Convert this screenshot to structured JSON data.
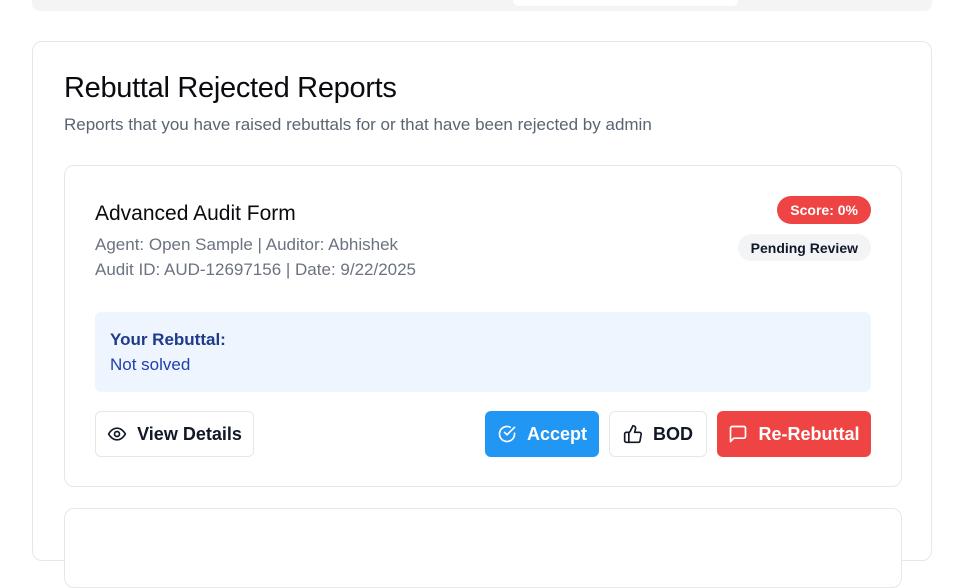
{
  "section": {
    "title": "Rebuttal Rejected Reports",
    "subtitle": "Reports that you have raised rebuttals for or that have been rejected by admin"
  },
  "report": {
    "form_name": "Advanced Audit Form",
    "agent_auditor": "Agent: Open Sample | Auditor: Abhishek",
    "audit_id_date": "Audit ID: AUD-12697156 | Date: 9/22/2025",
    "score_badge": "Score: 0%",
    "status_badge": "Pending Review",
    "rebuttal_label": "Your Rebuttal:",
    "rebuttal_text": "Not solved"
  },
  "actions": {
    "view_details": "View Details",
    "accept": "Accept",
    "bod": "BOD",
    "re_rebuttal": "Re-Rebuttal"
  },
  "icons": {
    "view": "eye-icon",
    "accept": "check-circle-icon",
    "bod": "thumbs-up-icon",
    "re_rebuttal": "message-square-icon"
  },
  "colors": {
    "accent_blue": "#2196f3",
    "danger_red": "#ef4444",
    "rebuttal_bg": "#eef5ff"
  }
}
